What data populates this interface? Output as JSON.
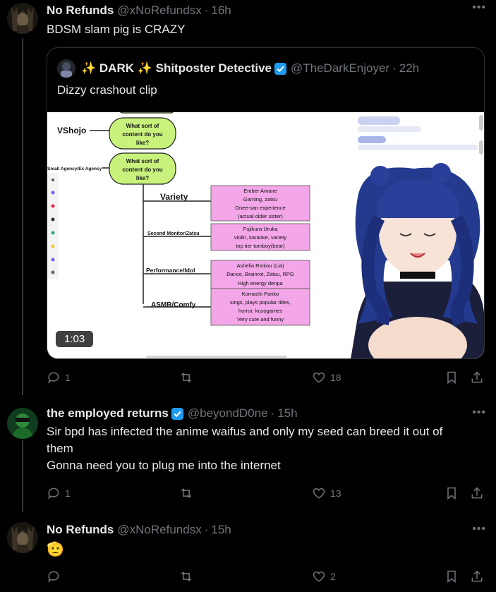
{
  "tweets": [
    {
      "name": "No Refunds",
      "handle": "@xNoRefundsx",
      "time": "16h",
      "text": "BDSM slam pig is CRAZY",
      "actions": {
        "replies": "1",
        "retweets": "",
        "likes": "18"
      },
      "quote": {
        "name": "✨ DARK ✨ Shitposter Detective",
        "handle": "@TheDarkEnjoyer",
        "time": "22h",
        "text": "Dizzy crashout clip",
        "video": {
          "duration": "1:03",
          "flowchart": {
            "left_labels": [
              "VShojo",
              "Small Agency/Ex Agency"
            ],
            "questions": [
              "What sort of content do you like?",
              "What sort of content do you like?"
            ],
            "branches": [
              "Variety",
              "Second Monitor/Zatsu",
              "Performance/Idol",
              "ASMR/Comfy"
            ],
            "boxes": [
              {
                "title": "Ember Amane",
                "lines": [
                  "Gaming, zatsu",
                  "Onee-san experience",
                  "(actual older sister)"
                ]
              },
              {
                "title": "Fujikura Uruka",
                "lines": [
                  "violin, karaoke, variety",
                  "top tier tomboy(bear)"
                ]
              },
              {
                "title": "Ashelia Rinkou (Lia)",
                "lines": [
                  "Dance, Brainrot, Zatsu, RPG",
                  "High energy denpa"
                ]
              },
              {
                "title": "Komachi Panko",
                "lines": [
                  "sings, plays popular titles,",
                  "horror, kusogames",
                  "Very cute and funny"
                ]
              }
            ]
          }
        }
      }
    },
    {
      "name": "the employed returns",
      "handle": "@beyondD0ne",
      "time": "15h",
      "text_line1": "Sir bpd has infected the anime waifus and only my seed can breed it out of",
      "text_line2": "them",
      "text_line3": "Gonna need you to plug me into the internet",
      "actions": {
        "replies": "1",
        "retweets": "",
        "likes": "13"
      }
    },
    {
      "name": "No Refunds",
      "handle": "@xNoRefundsx",
      "time": "15h",
      "text": "🫡",
      "actions": {
        "replies": "",
        "retweets": "",
        "likes": "2"
      }
    }
  ],
  "colors": {
    "background": "#000000",
    "text": "#e7e9ea",
    "muted": "#71767b",
    "verified": "#1d9bf0",
    "box_pink": "#f3a6e8",
    "bubble_green": "#c9f27d"
  }
}
